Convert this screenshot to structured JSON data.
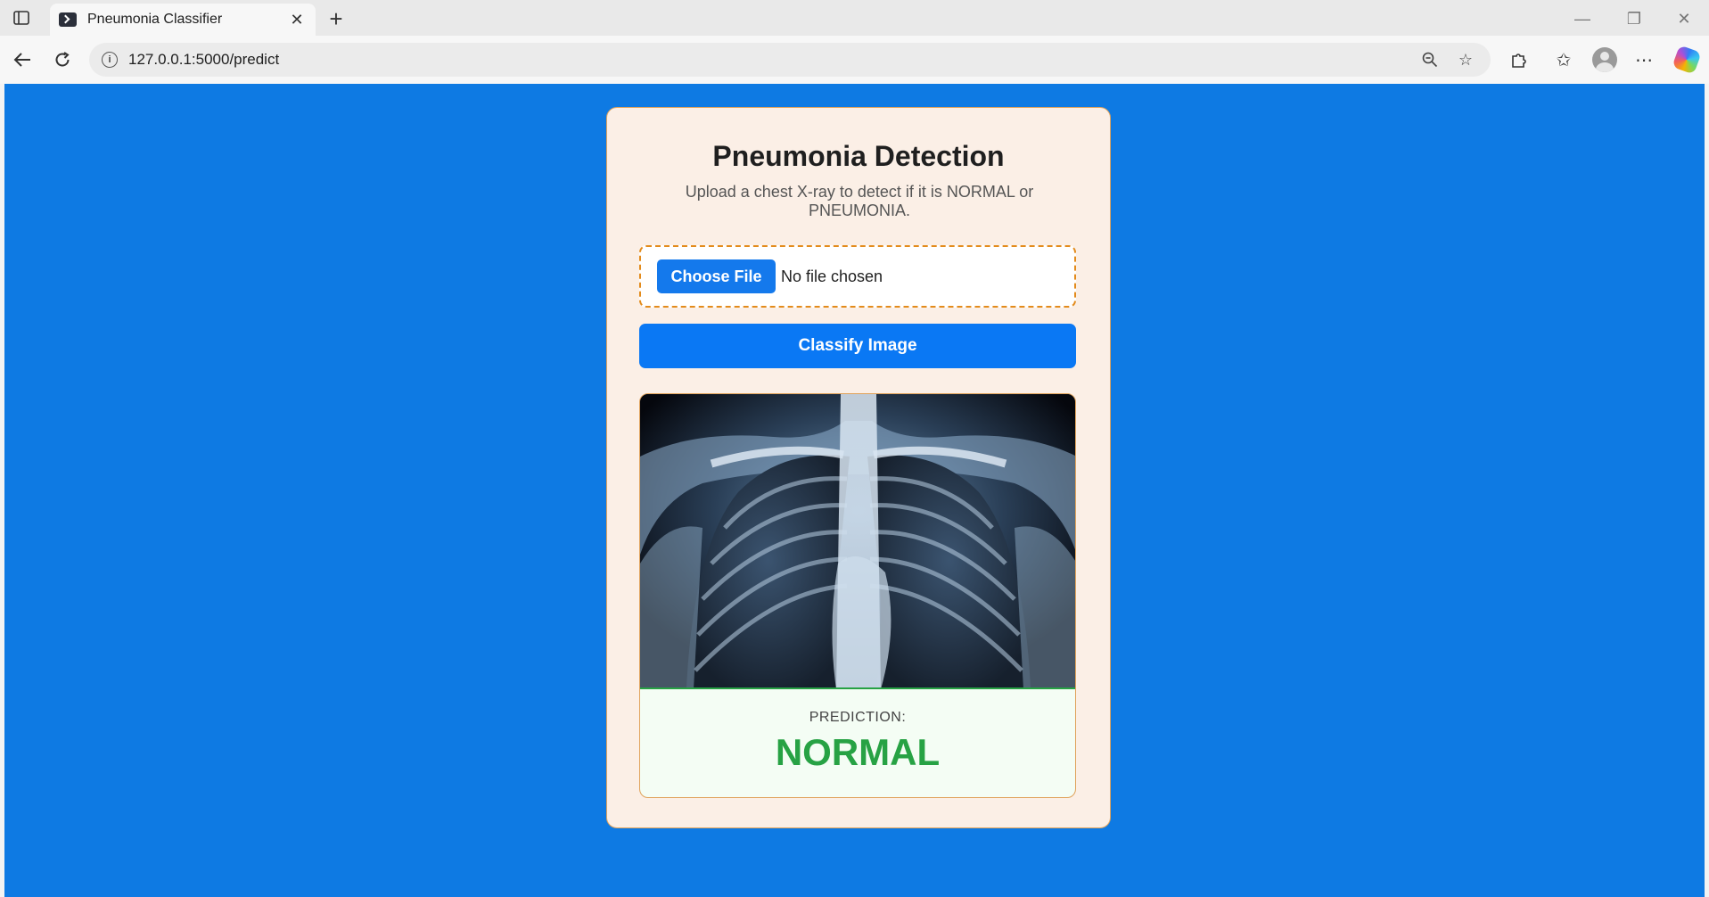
{
  "browser": {
    "tab_title": "Pneumonia Classifier",
    "url": "127.0.0.1:5000/predict"
  },
  "icons": {
    "tab_actions": "tab-actions-icon",
    "favicon": "terminal-icon",
    "close": "close-icon",
    "new_tab": "plus-icon",
    "back": "back-arrow-icon",
    "reload": "reload-icon",
    "site_info": "info-icon",
    "zoom": "zoom-out-icon",
    "favorite": "star-icon",
    "extensions": "puzzle-icon",
    "favorites": "favorites-icon",
    "profile": "avatar-icon",
    "menu": "more-icon",
    "copilot": "copilot-icon"
  },
  "page": {
    "background": "#0e7ae3",
    "card": {
      "title": "Pneumonia Detection",
      "subtitle": "Upload a chest X-ray to detect if it is NORMAL or PNEUMONIA.",
      "choose_file_label": "Choose File",
      "file_status": "No file chosen",
      "classify_label": "Classify Image",
      "prediction_label": "PREDICTION:",
      "prediction_value": "NORMAL",
      "prediction_color": "#27a244"
    }
  }
}
